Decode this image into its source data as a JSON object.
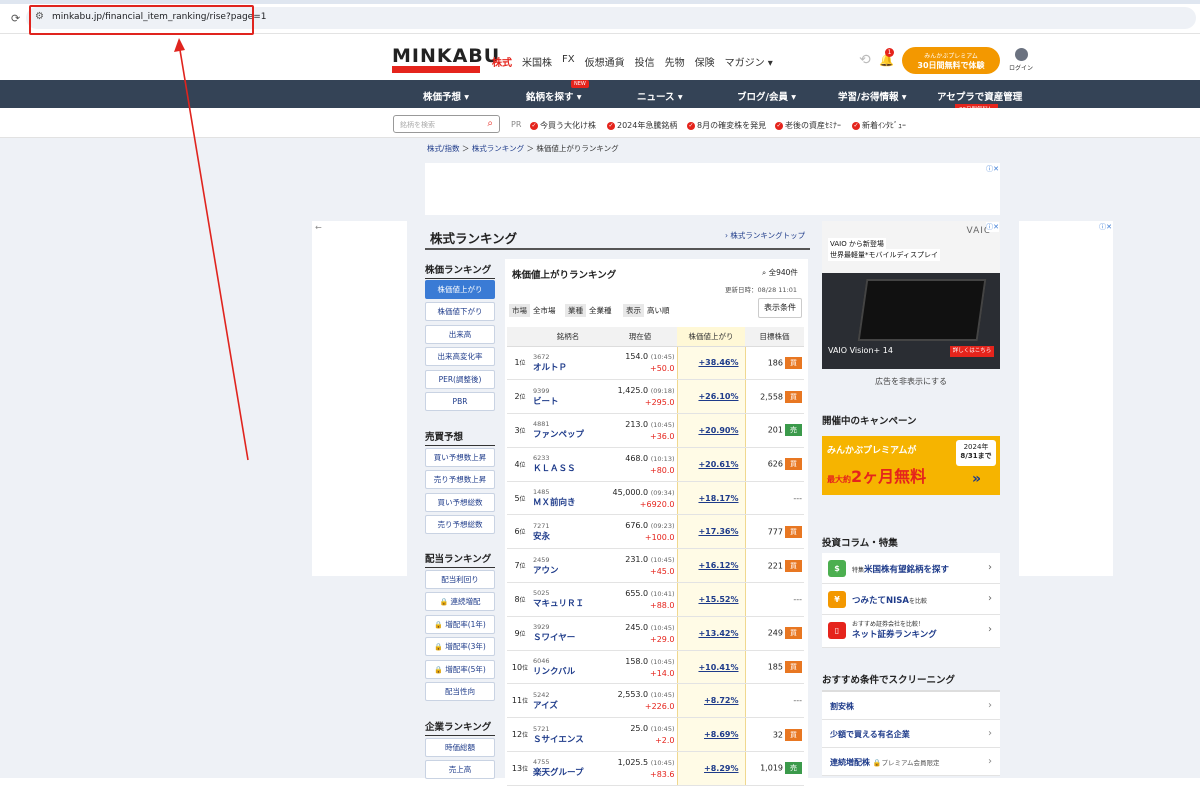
{
  "browser": {
    "url": "minkabu.jp/financial_item_ranking/rise?page=1"
  },
  "header": {
    "logo": "MINKABU",
    "nav": [
      "株式",
      "米国株",
      "FX",
      "仮想通貨",
      "投信",
      "先物",
      "保険",
      "マガジン ▾"
    ],
    "bell_count": "1",
    "premium_line1": "みんかぶプレミアム",
    "premium_line2": "30日間無料で体験",
    "login": "ログイン"
  },
  "mainnav": {
    "items": [
      "株価予想 ▾",
      "銘柄を探す ▾",
      "ニュース ▾",
      "ブログ/会員 ▾",
      "学習/お得情報 ▾",
      "アセプラで資産管理"
    ],
    "new_tag": "NEW",
    "free_tag": "30日間無料！"
  },
  "subbar": {
    "search_placeholder": "銘柄を検索",
    "pr": "PR",
    "links": [
      "今買う大化け株",
      "2024年急騰銘柄",
      "8月の確変株を発見",
      "老後の資産ｾﾐﾅｰ",
      "新着ｲﾝﾀﾋﾞｭｰ"
    ]
  },
  "breadcrumb": [
    "株式/指数",
    "株式ランキング",
    "株価値上がりランキング"
  ],
  "main": {
    "title": "株式ランキング",
    "top_link": "株式ランキングトップ"
  },
  "sidebar": {
    "sections": [
      {
        "heading": "株価ランキング",
        "items": [
          "株価値上がり",
          "株価値下がり",
          "出来高",
          "出来高変化率",
          "PER(調整後)",
          "PBR"
        ]
      },
      {
        "heading": "売買予想",
        "items": [
          "買い予想数上昇",
          "売り予想数上昇",
          "買い予想総数",
          "売り予想総数"
        ]
      },
      {
        "heading": "配当ランキング",
        "items": [
          "配当利回り",
          "連続増配",
          "増配率(1年)",
          "増配率(3年)",
          "増配率(5年)",
          "配当性向"
        ]
      },
      {
        "heading": "企業ランキング",
        "items": [
          "時価総額",
          "売上高"
        ]
      }
    ]
  },
  "ranking": {
    "title": "株価値上がりランキング",
    "count": "全940件",
    "updated": "更新日時：08/28 11:01",
    "filters": [
      {
        "key": "市場",
        "value": "全市場"
      },
      {
        "key": "業種",
        "value": "全業種"
      },
      {
        "key": "表示",
        "value": "高い順"
      }
    ],
    "cond_button": "表示条件",
    "columns": [
      "銘柄名",
      "現在値",
      "株価値上がり",
      "目標株価"
    ],
    "rank_suffix": "位",
    "rows": [
      {
        "rank": "1",
        "code": "3672",
        "name": "オルトＰ",
        "price": "154.0",
        "time": "(10:45)",
        "change": "+50.0",
        "pct": "+38.46%",
        "target": "186",
        "badge": "買"
      },
      {
        "rank": "2",
        "code": "9399",
        "name": "ビート",
        "price": "1,425.0",
        "time": "(09:18)",
        "change": "+295.0",
        "pct": "+26.10%",
        "target": "2,558",
        "badge": "買"
      },
      {
        "rank": "3",
        "code": "4881",
        "name": "ファンペップ",
        "price": "213.0",
        "time": "(10:45)",
        "change": "+36.0",
        "pct": "+20.90%",
        "target": "201",
        "badge": "売"
      },
      {
        "rank": "4",
        "code": "6233",
        "name": "ＫＬＡＳＳ",
        "price": "468.0",
        "time": "(10:13)",
        "change": "+80.0",
        "pct": "+20.61%",
        "target": "626",
        "badge": "買"
      },
      {
        "rank": "5",
        "code": "1485",
        "name": "ＭＸ前向き",
        "price": "45,000.0",
        "time": "(09:34)",
        "change": "+6920.0",
        "pct": "+18.17%",
        "target": "---",
        "badge": ""
      },
      {
        "rank": "6",
        "code": "7271",
        "name": "安永",
        "price": "676.0",
        "time": "(09:23)",
        "change": "+100.0",
        "pct": "+17.36%",
        "target": "777",
        "badge": "買"
      },
      {
        "rank": "7",
        "code": "2459",
        "name": "アウン",
        "price": "231.0",
        "time": "(10:45)",
        "change": "+45.0",
        "pct": "+16.12%",
        "target": "221",
        "badge": "買"
      },
      {
        "rank": "8",
        "code": "5025",
        "name": "マキュリＲＩ",
        "price": "655.0",
        "time": "(10:41)",
        "change": "+88.0",
        "pct": "+15.52%",
        "target": "---",
        "badge": ""
      },
      {
        "rank": "9",
        "code": "3929",
        "name": "Ｓワイヤー",
        "price": "245.0",
        "time": "(10:45)",
        "change": "+29.0",
        "pct": "+13.42%",
        "target": "249",
        "badge": "買"
      },
      {
        "rank": "10",
        "code": "6046",
        "name": "リンクバル",
        "price": "158.0",
        "time": "(10:45)",
        "change": "+14.0",
        "pct": "+10.41%",
        "target": "185",
        "badge": "買"
      },
      {
        "rank": "11",
        "code": "5242",
        "name": "アイズ",
        "price": "2,553.0",
        "time": "(10:45)",
        "change": "+226.0",
        "pct": "+8.72%",
        "target": "---",
        "badge": ""
      },
      {
        "rank": "12",
        "code": "5721",
        "name": "Ｓサイエンス",
        "price": "25.0",
        "time": "(10:45)",
        "change": "+2.0",
        "pct": "+8.69%",
        "target": "32",
        "badge": "買"
      },
      {
        "rank": "13",
        "code": "4755",
        "name": "楽天グループ",
        "price": "1,025.5",
        "time": "(10:45)",
        "change": "+83.6",
        "pct": "+8.29%",
        "target": "1,019",
        "badge": "売"
      }
    ]
  },
  "rightcol": {
    "ad": {
      "line1": "VAIO から新登場",
      "line2": "世界最軽量*モバイルディスプレイ",
      "brand": "VAIO",
      "product": "VAIO Vision+ 14",
      "button": "詳しくはこちら"
    },
    "hide_ad": "広告を非表示にする",
    "campaign_heading": "開催中のキャンペーン",
    "campaign": {
      "line1": "みんかぶプレミアムが",
      "line2_pre": "最大約",
      "line2_main": "2ヶ月無料",
      "date1": "2024年",
      "date2": "8/31まで"
    },
    "columns_heading": "投資コラム・特集",
    "columns": [
      {
        "tag": "特集",
        "label": "米国株有望銘柄を探す",
        "icon_color": "#4caf50"
      },
      {
        "tag": "",
        "label": "つみたてNISA",
        "suffix": "を比較",
        "icon_color": "#f39800"
      },
      {
        "tag": "おすすめ証券会社を比較！",
        "label": "ネット証券ランキング",
        "icon_color": "#e5241c"
      }
    ],
    "screening_heading": "おすすめ条件でスクリーニング",
    "screening": [
      {
        "label": "割安株",
        "note": ""
      },
      {
        "label": "少額で買える有名企業",
        "note": ""
      },
      {
        "label": "連続増配株",
        "note": "プレミアム会員限定"
      }
    ]
  }
}
